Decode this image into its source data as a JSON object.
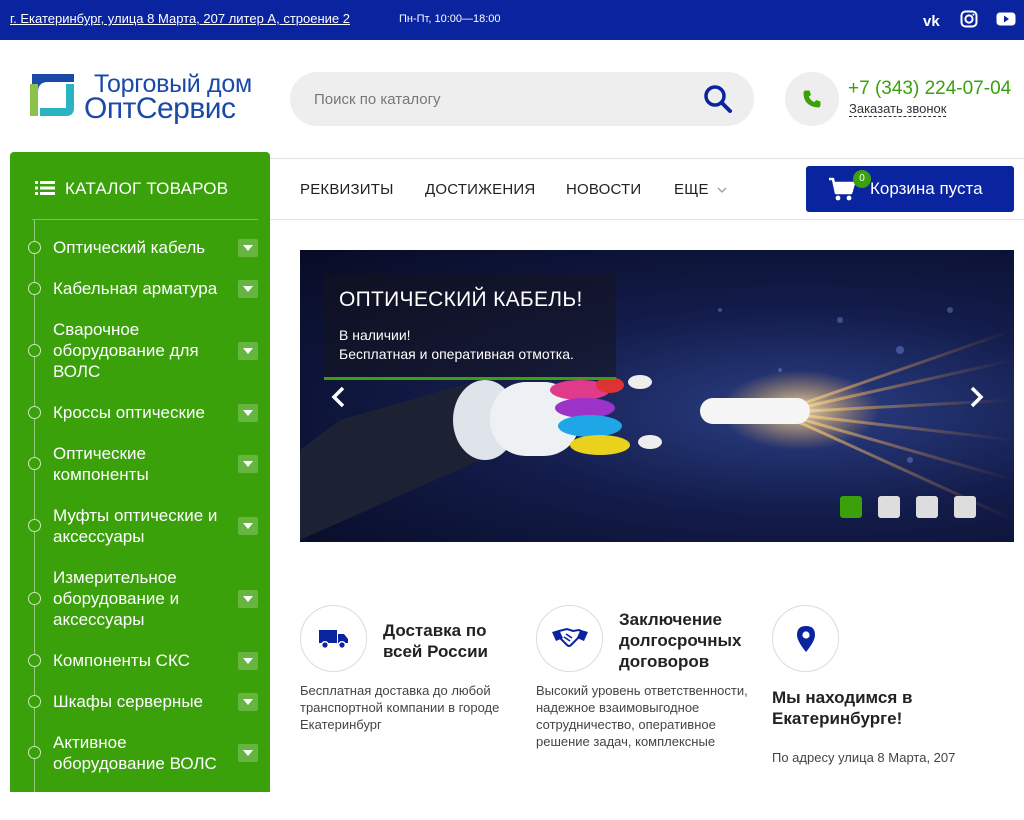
{
  "topbar": {
    "address": "г. Екатеринбург, улица 8 Марта, 207 литер А, строение 2",
    "hours": "Пн-Пт, 10:00—18:00",
    "social": [
      "vk-icon",
      "instagram-icon",
      "youtube-icon"
    ]
  },
  "header": {
    "logo_line1": "Торговый дом",
    "logo_line2": "ОптСервис",
    "search_placeholder": "Поиск по каталогу",
    "phone": "+7 (343) 224-07-04",
    "callback": "Заказать звонок"
  },
  "nav": {
    "items": [
      "РЕКВИЗИТЫ",
      "ДОСТИЖЕНИЯ",
      "НОВОСТИ",
      "ЕЩЕ"
    ],
    "cart_label": "Корзина пуста",
    "cart_count": "0"
  },
  "sidebar": {
    "title": "КАТАЛОГ ТОВАРОВ",
    "items": [
      "Оптический кабель",
      "Кабельная арматура",
      "Сварочное оборудование для ВОЛС",
      "Кроссы оптические",
      "Оптические компоненты",
      "Муфты оптические и аксессуары",
      "Измерительное оборудование и аксессуары",
      "Компоненты СКС",
      "Шкафы серверные",
      "Активное оборудование ВОЛС"
    ]
  },
  "slider": {
    "title": "ОПТИЧЕСКИЙ КАБЕЛЬ!",
    "line1": "В наличии!",
    "line2": "Бесплатная и оперативная отмотка.",
    "slide_count": 4,
    "active_slide": 1
  },
  "features": [
    {
      "title": "Доставка по всей России",
      "text": "Бесплатная доставка до любой транспортной компании в городе Екатеринбург",
      "icon": "truck-icon"
    },
    {
      "title": "Заключение долгосрочных договоров",
      "text": "Высокий уровень ответственности, надежное взаимовыгодное сотрудничество, оперативное решение задач, комплексные",
      "icon": "handshake-icon"
    },
    {
      "title": "Мы находимся в Екатеринбурге!",
      "text": "По адресу улица 8 Марта, 207",
      "icon": "location-pin-icon"
    }
  ],
  "colors": {
    "brand_blue": "#0a24a0",
    "brand_green": "#3aa10b"
  }
}
